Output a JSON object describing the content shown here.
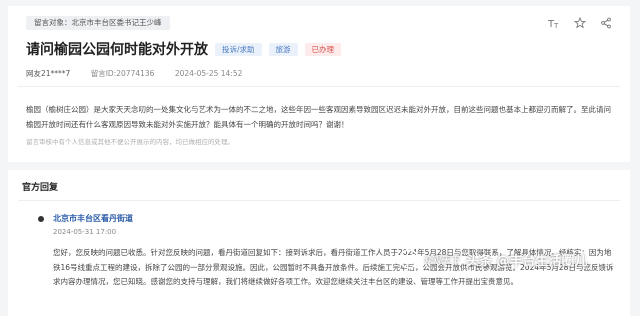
{
  "message": {
    "to_label": "留言对象：北京市丰台区委书记王少峰",
    "title": "请问榆园公园何时能对外开放",
    "badges": [
      "投诉/求助",
      "旅游",
      "已办理"
    ],
    "user": "网友21****7",
    "message_id": "留言ID:20774136",
    "datetime": "2024-05-25 14:52",
    "body": "榆园（榆树庄公园）是大家天天念叨的一处集文化与艺术为一体的不二之地，这些年因一些客观因素导致园区迟迟未能对外开放，目前这些问题也基本上都迎刃而解了。至此请问榆园开放时间还有什么客观原因导致未能对外实施开放？能具体有一个明确的开放时间吗？谢谢！",
    "note": "留言审核中有个人信息或其他不便公开展示的内容，均已做相应的处理。",
    "icons": [
      "font-size-icon",
      "star-icon",
      "share-icon"
    ]
  },
  "reply": {
    "section_title": "官方回复",
    "from": "北京市丰台区看丹街道",
    "date": "2024-05-31 17:00",
    "body": "您好，您反映的问题已收悉。针对您反映的问题，看丹街道回复如下：接到诉求后，看丹街道工作人员于2024年5月28日与您取得联系，了解具体情况。经核实：因为地铁16号线重点工程的建设，拆除了公园的一部分景观设施。因此，公园暂时不具备开放条件。后续施工完毕后，公园会开放供市民参观游览。2024年5月28日与您反馈诉求内容办理情况，您已知晓。感谢您的支持与理解，我们将继续做好各项工作。欢迎您继续关注丰台区的建设、管理等工作开提出宝贵意见。"
  },
  "watermark": {
    "small": "众观天下",
    "main": "头条 @丰台生活圈儿"
  }
}
